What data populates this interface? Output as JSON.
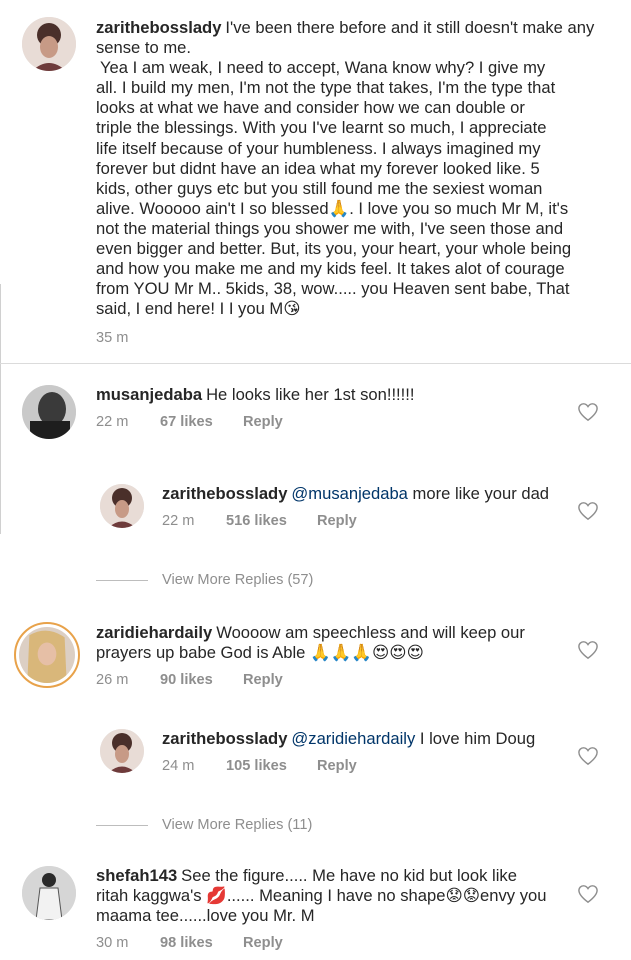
{
  "caption": {
    "username": "zarithebosslady",
    "text": "I've been there before and it still doesn't make any sense to me.",
    "lines": [
      "Yea I am weak, I need to accept, Wana know why? I give my",
      "all. I build my men, I'm not the type that takes, I'm the type that",
      "looks at what we have and consider how we can double or",
      "triple the blessings.  With you I've learnt  so much, I appreciate",
      "life itself because of your humbleness. I always imagined my",
      "forever but didnt have an idea what my forever looked like. 5",
      "kids, other guys etc but you still found me the sexiest woman",
      "alive. Wooooo ain't I so blessed🙏. I love you so much Mr M, it's",
      "not the material things you shower me with, I've seen those and",
      "even bigger and better.  But, its you, your heart, your whole being",
      "and how you make me and my kids feel. It takes alot of courage",
      "from YOU Mr M.. 5kids, 38,  wow..... you Heaven sent babe, That",
      "said, I end here! I I you M😘"
    ],
    "time": "35 m"
  },
  "comments": [
    {
      "username": "musanjedaba",
      "text": "He looks like her 1st son!!!!!!",
      "time": "22 m",
      "likes": "67 likes",
      "reply": "Reply"
    },
    {
      "username": "zarithebosslady",
      "mention": "@musanjedaba",
      "text": "more like your dad",
      "time": "22 m",
      "likes": "516 likes",
      "reply": "Reply"
    },
    {
      "view_more": "View More Replies (57)"
    },
    {
      "username": "zaridiehardaily",
      "text": "Woooow am speechless and will keep our",
      "text2": "prayers up babe God is Able 🙏🙏🙏😍😍😍",
      "time": "26 m",
      "likes": "90 likes",
      "reply": "Reply"
    },
    {
      "username": "zarithebosslady",
      "mention": "@zaridiehardaily",
      "text": "I love him Doug",
      "time": "24 m",
      "likes": "105 likes",
      "reply": "Reply"
    },
    {
      "view_more": "View More Replies (11)"
    },
    {
      "username": "shefah143",
      "text": "See the figure..... Me have no kid but look like",
      "text2": "ritah kaggwa's 💋...... Meaning I have no shape😟😟envy you",
      "text3": "maama tee......love you Mr. M",
      "time": "30 m",
      "likes": "98 likes",
      "reply": "Reply"
    }
  ],
  "icons": {
    "like": "heart-outline-icon"
  },
  "colors": {
    "text": "#262626",
    "muted": "#8e8e8e",
    "mention": "#003569"
  }
}
